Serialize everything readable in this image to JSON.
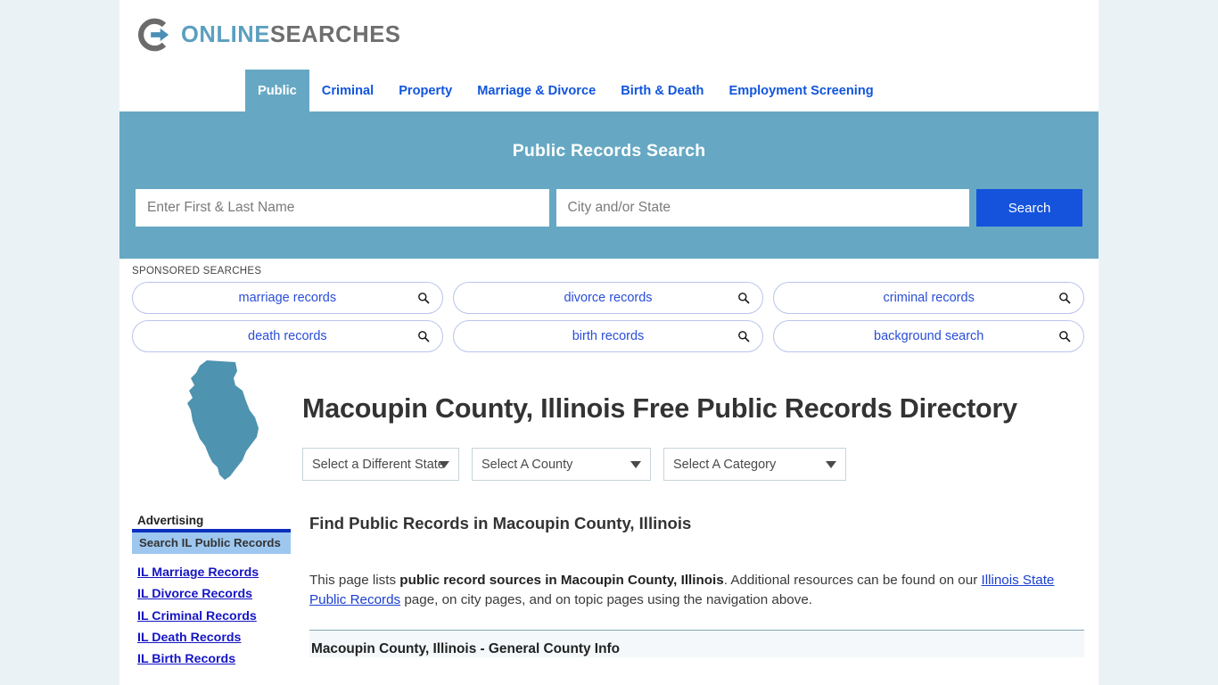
{
  "brand": {
    "name_part1": "ONLINE",
    "name_part2": "SEARCHES",
    "logo_icon": "circle-arrow-icon",
    "accent_blue": "#5b9fbf",
    "accent_gray": "#6e6e6e"
  },
  "nav": {
    "items": [
      {
        "label": "Public",
        "active": true
      },
      {
        "label": "Criminal",
        "active": false
      },
      {
        "label": "Property",
        "active": false
      },
      {
        "label": "Marriage & Divorce",
        "active": false
      },
      {
        "label": "Birth & Death",
        "active": false
      },
      {
        "label": "Employment Screening",
        "active": false
      }
    ],
    "active_bg": "#66a8c3",
    "link_color": "#1155dd"
  },
  "hero": {
    "title": "Public Records Search",
    "background": "#66a8c3",
    "name_placeholder": "Enter First & Last Name",
    "name_value": "",
    "location_placeholder": "City and/or State",
    "location_value": "",
    "search_button": "Search",
    "search_button_color": "#1553dd"
  },
  "sponsored": {
    "label": "SPONSORED SEARCHES",
    "icon": "magnifier-icon",
    "row1": [
      "marriage records",
      "divorce records",
      "criminal records"
    ],
    "row2": [
      "death records",
      "birth records",
      "background search"
    ]
  },
  "title_block": {
    "state_icon": "illinois-state-outline-icon",
    "state_color": "#4e93b0",
    "heading": "Macoupin County, Illinois Free Public Records Directory"
  },
  "selects": {
    "state": {
      "label": "Select a Different State",
      "caret": "chevron-down-icon"
    },
    "county": {
      "label": "Select A County",
      "caret": "chevron-down-icon"
    },
    "category": {
      "label": "Select A Category",
      "caret": "chevron-down-icon"
    }
  },
  "sidebar": {
    "advertising_label": "Advertising",
    "ad_box_title": "Search IL Public Records",
    "links": [
      "IL Marriage Records",
      "IL Divorce Records",
      "IL Criminal Records",
      "IL Death Records",
      "IL Birth Records"
    ]
  },
  "main": {
    "section_heading": "Find Public Records in Macoupin County, Illinois",
    "para_prefix": "This page lists ",
    "para_bold": "public record sources in Macoupin County, Illinois",
    "para_mid": ". Additional resources can be found on our ",
    "para_link": "Illinois State Public Records",
    "para_suffix": " page, on city pages, and on topic pages using the navigation above.",
    "info_strip_title": "Macoupin County, Illinois - General County Info"
  }
}
